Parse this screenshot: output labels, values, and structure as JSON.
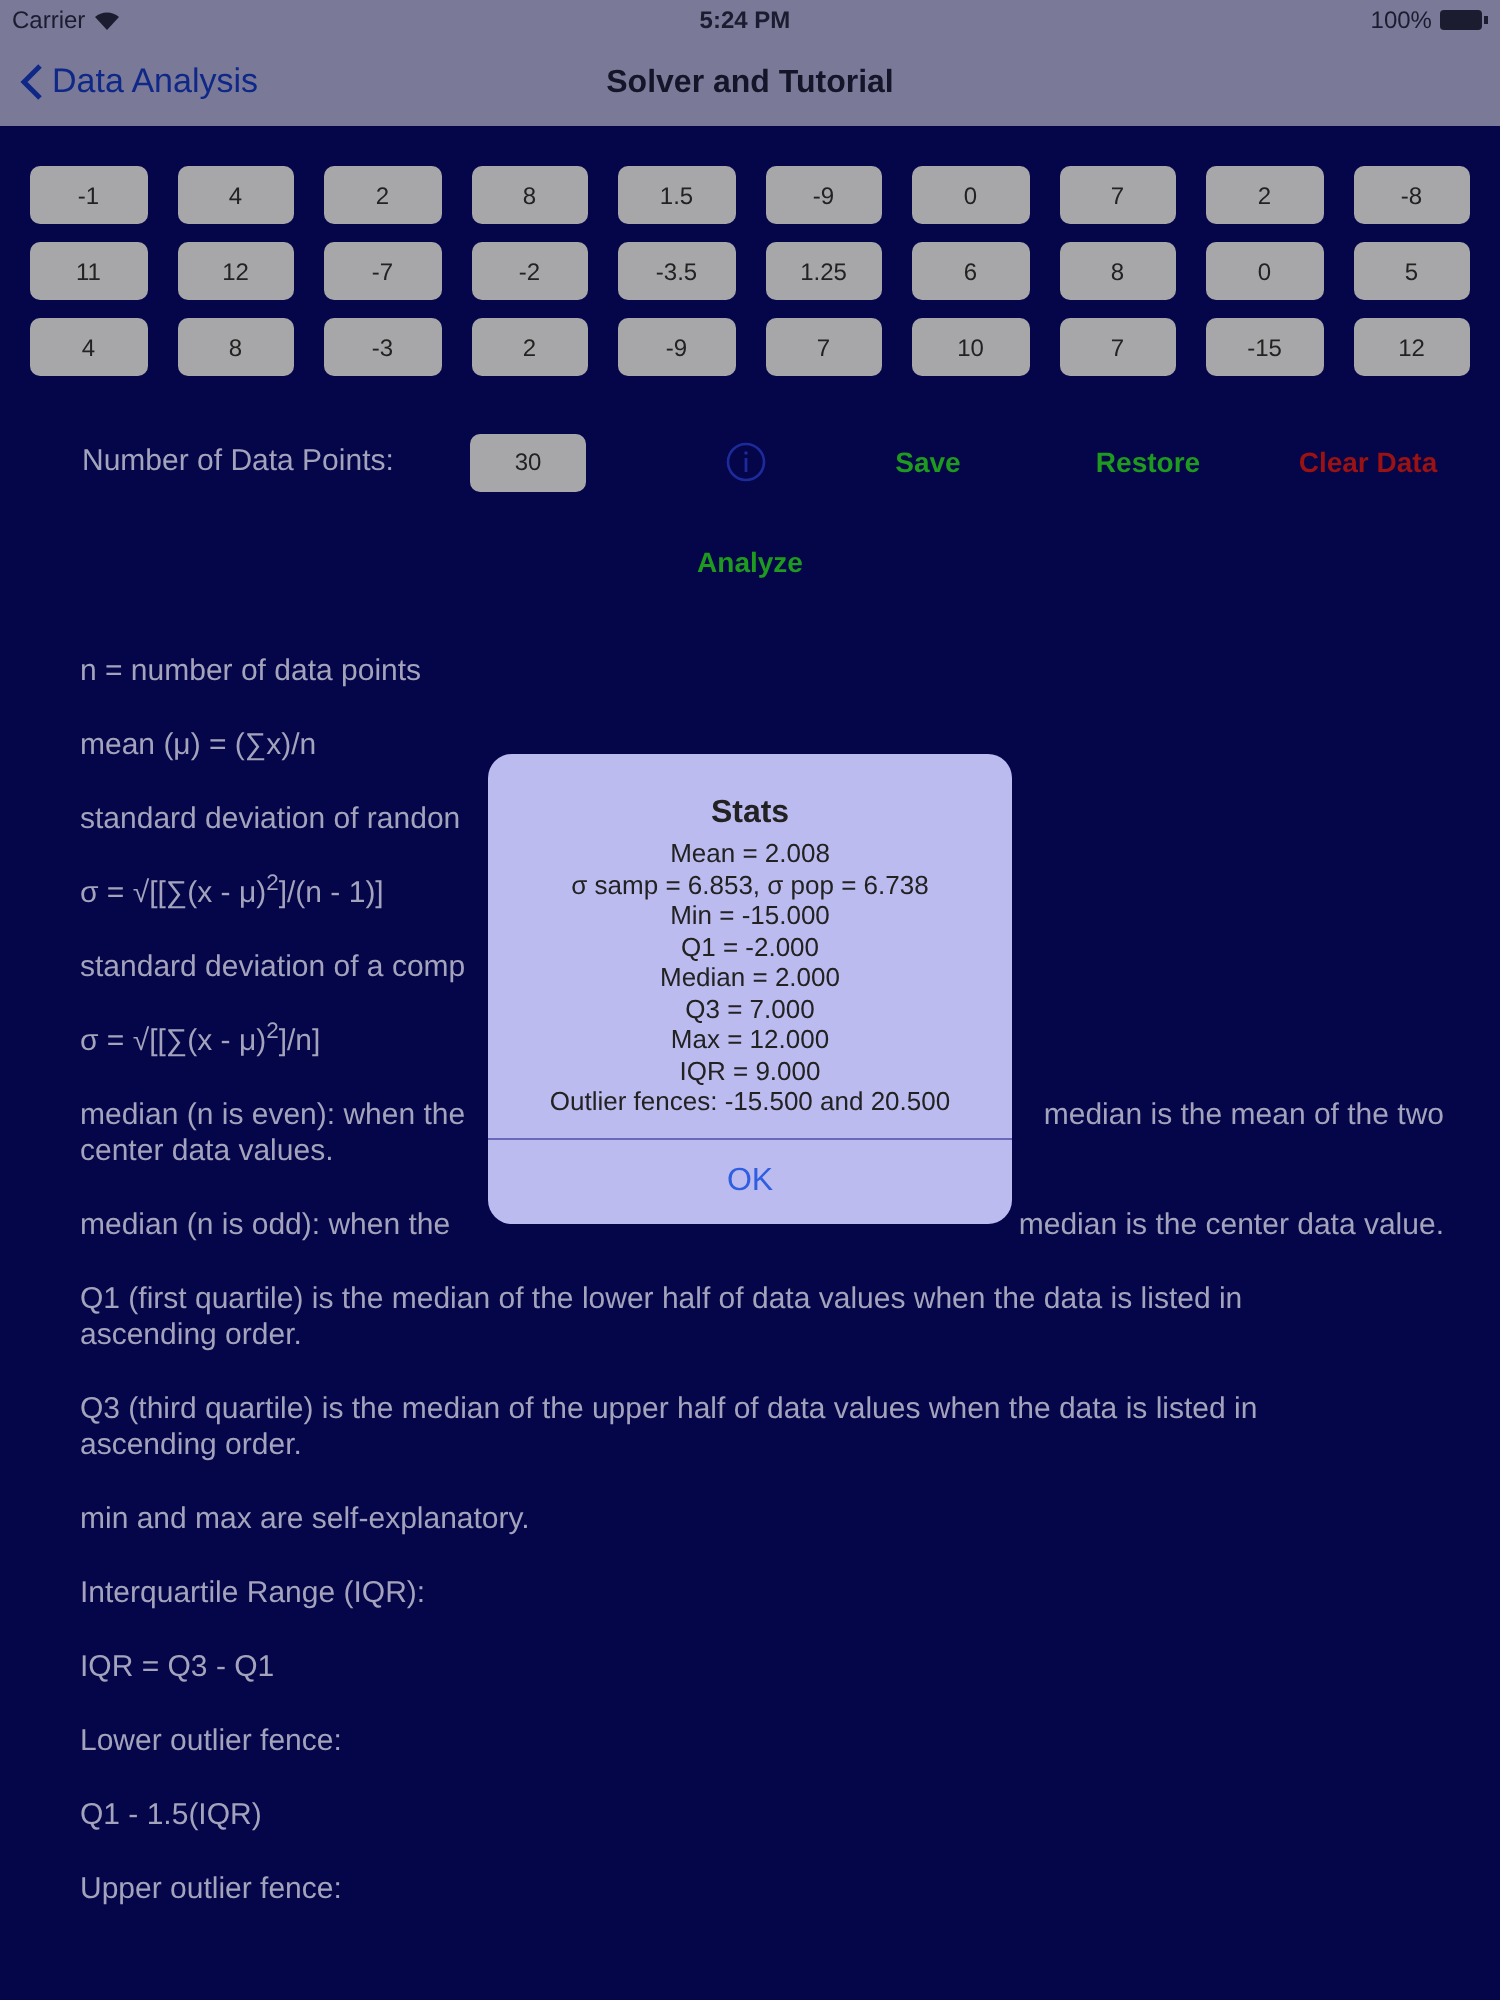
{
  "status_bar": {
    "carrier": "Carrier",
    "time": "5:24 PM",
    "battery": "100%"
  },
  "nav": {
    "back": "Data Analysis",
    "title": "Solver and Tutorial"
  },
  "data_grid": [
    [
      "-1",
      "4",
      "2",
      "8",
      "1.5",
      "-9",
      "0",
      "7",
      "2",
      "-8"
    ],
    [
      "11",
      "12",
      "-7",
      "-2",
      "-3.5",
      "1.25",
      "6",
      "8",
      "0",
      "5"
    ],
    [
      "4",
      "8",
      "-3",
      "2",
      "-9",
      "7",
      "10",
      "7",
      "-15",
      "12"
    ]
  ],
  "controls": {
    "label": "Number of Data Points:",
    "count": "30",
    "actions": [
      {
        "label": "Save",
        "color": "#1e9a1e"
      },
      {
        "label": "Restore",
        "color": "#1e9a1e"
      },
      {
        "label": "Clear Data",
        "color": "#9a1212"
      }
    ],
    "analyze": "Analyze"
  },
  "tutorial": [
    {
      "lines": [
        {
          "left": "n = number of data points"
        }
      ]
    },
    {
      "lines": [
        {
          "left": "mean (μ) = (∑x)/n"
        }
      ]
    },
    {
      "lines": [
        {
          "left": "standard deviation of randon"
        }
      ]
    },
    {
      "lines": [
        {
          "left": "σ = √[[∑(x - μ)$^{2}$]/(n - 1)]"
        }
      ]
    },
    {
      "lines": [
        {
          "left": "standard deviation of a comp"
        }
      ]
    },
    {
      "lines": [
        {
          "left": "σ = √[[∑(x - μ)$^{2}$]/n]"
        }
      ]
    },
    {
      "lines": [
        {
          "left": "median (n is even): when the",
          "right": "median is the mean of the two"
        },
        {
          "left": "center data values."
        }
      ]
    },
    {
      "lines": [
        {
          "left": "median (n is odd): when the",
          "right": "median is the center data value."
        }
      ]
    },
    {
      "lines": [
        {
          "left": "Q1 (first quartile) is the median of the lower half of data values when the data is listed in"
        },
        {
          "left": "ascending order."
        }
      ]
    },
    {
      "lines": [
        {
          "left": "Q3 (third quartile) is the median of the upper half of data values when the data is listed in"
        },
        {
          "left": "ascending order."
        }
      ]
    },
    {
      "lines": [
        {
          "left": "min and max are self-explanatory."
        }
      ]
    },
    {
      "lines": [
        {
          "left": "Interquartile Range (IQR):"
        }
      ]
    },
    {
      "lines": [
        {
          "left": "IQR = Q3 - Q1"
        }
      ]
    },
    {
      "lines": [
        {
          "left": "Lower outlier fence:"
        }
      ]
    },
    {
      "lines": [
        {
          "left": "Q1 - 1.5(IQR)"
        }
      ]
    },
    {
      "lines": [
        {
          "left": "Upper outlier fence:"
        }
      ]
    }
  ],
  "alert": {
    "title": "Stats",
    "lines": [
      "Mean = 2.008",
      "σ samp = 6.853, σ pop = 6.738",
      "Min = -15.000",
      "Q1 = -2.000",
      "Median = 2.000",
      "Q3 = 7.000",
      "Max = 12.000",
      "IQR = 9.000",
      "Outlier fences: -15.500 and 20.500"
    ],
    "button": "OK"
  }
}
